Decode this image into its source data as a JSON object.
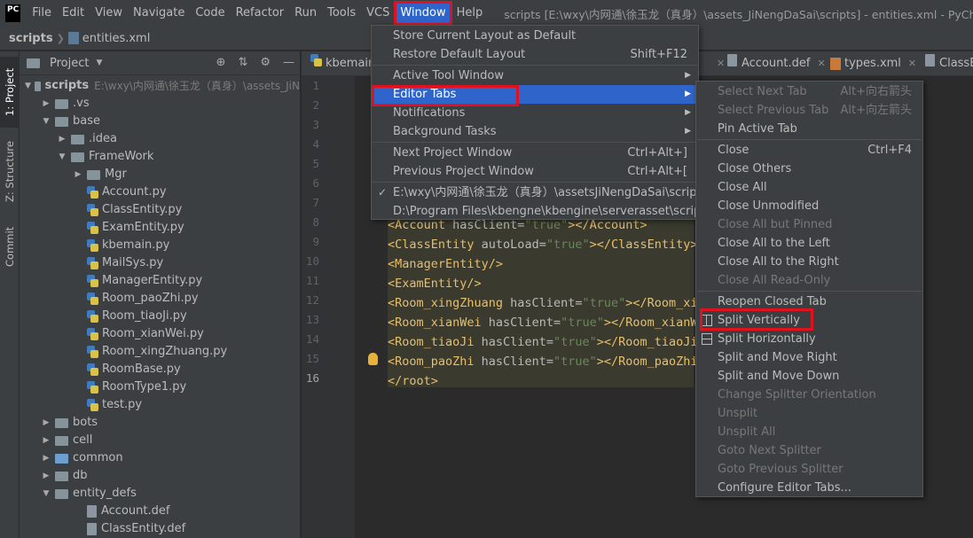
{
  "app": {
    "logo_text": "PC",
    "title": "scripts [E:\\wxy\\内网通\\徐玉龙（真身）\\assets_JiNengDaSai\\scripts] - entities.xml - PyCharm"
  },
  "menubar": [
    "File",
    "Edit",
    "View",
    "Navigate",
    "Code",
    "Refactor",
    "Run",
    "Tools",
    "VCS",
    "Window",
    "Help"
  ],
  "navbar": {
    "root": "scripts",
    "file": "entities.xml"
  },
  "toolstrip": {
    "project": "1: Project",
    "structure": "Z: Structure",
    "commit": "Commit"
  },
  "project_panel": {
    "title": "Project",
    "root": {
      "name": "scripts",
      "path": "E:\\wxy\\内网通\\徐玉龙（真身）\\assets_JiN"
    },
    "rows": [
      {
        "label": ".vs",
        "depth": 1,
        "kind": "folder",
        "arrow": "▶"
      },
      {
        "label": "base",
        "depth": 1,
        "kind": "folder",
        "arrow": "▼"
      },
      {
        "label": ".idea",
        "depth": 2,
        "kind": "folder",
        "arrow": "▶"
      },
      {
        "label": "FrameWork",
        "depth": 2,
        "kind": "folder",
        "arrow": "▼"
      },
      {
        "label": "Mgr",
        "depth": 3,
        "kind": "folder",
        "arrow": "▶"
      },
      {
        "label": "Account.py",
        "depth": 3,
        "kind": "py",
        "arrow": ""
      },
      {
        "label": "ClassEntity.py",
        "depth": 3,
        "kind": "py",
        "arrow": ""
      },
      {
        "label": "ExamEntity.py",
        "depth": 3,
        "kind": "py",
        "arrow": ""
      },
      {
        "label": "kbemain.py",
        "depth": 3,
        "kind": "py",
        "arrow": ""
      },
      {
        "label": "MailSys.py",
        "depth": 3,
        "kind": "py",
        "arrow": ""
      },
      {
        "label": "ManagerEntity.py",
        "depth": 3,
        "kind": "py",
        "arrow": ""
      },
      {
        "label": "Room_paoZhi.py",
        "depth": 3,
        "kind": "py",
        "arrow": ""
      },
      {
        "label": "Room_tiaoJi.py",
        "depth": 3,
        "kind": "py",
        "arrow": ""
      },
      {
        "label": "Room_xianWei.py",
        "depth": 3,
        "kind": "py",
        "arrow": ""
      },
      {
        "label": "Room_xingZhuang.py",
        "depth": 3,
        "kind": "py",
        "arrow": ""
      },
      {
        "label": "RoomBase.py",
        "depth": 3,
        "kind": "py",
        "arrow": ""
      },
      {
        "label": "RoomType1.py",
        "depth": 3,
        "kind": "py",
        "arrow": ""
      },
      {
        "label": "test.py",
        "depth": 3,
        "kind": "py",
        "arrow": ""
      },
      {
        "label": "bots",
        "depth": 1,
        "kind": "folder",
        "arrow": "▶"
      },
      {
        "label": "cell",
        "depth": 1,
        "kind": "folder",
        "arrow": "▶"
      },
      {
        "label": "common",
        "depth": 1,
        "kind": "folder-blue",
        "arrow": "▶"
      },
      {
        "label": "db",
        "depth": 1,
        "kind": "folder",
        "arrow": "▶"
      },
      {
        "label": "entity_defs",
        "depth": 1,
        "kind": "folder",
        "arrow": "▼"
      },
      {
        "label": "Account.def",
        "depth": 3,
        "kind": "def",
        "arrow": ""
      },
      {
        "label": "ClassEntity.def",
        "depth": 3,
        "kind": "def",
        "arrow": ""
      }
    ]
  },
  "editor": {
    "tabs": [
      "kbemain",
      "Account.def",
      "types.xml",
      "ClassEn"
    ],
    "line_numbers": [
      "1",
      "2",
      "3",
      "4",
      "5",
      "6",
      "7",
      "8",
      "9",
      "10",
      "11",
      "12",
      "13",
      "14",
      "15",
      "16"
    ],
    "code_lines": [
      {
        "line": 8,
        "parts": [
          [
            "tag",
            "<Account "
          ],
          [
            "attr",
            "hasClient="
          ],
          [
            "val",
            "\"true\""
          ],
          [
            "tag",
            "></Account>"
          ]
        ]
      },
      {
        "line": 9,
        "parts": [
          [
            "tag",
            "<ClassEntity "
          ],
          [
            "attr",
            "autoLoad="
          ],
          [
            "val",
            "\"true\""
          ],
          [
            "tag",
            "></ClassEntity>"
          ]
        ]
      },
      {
        "line": 10,
        "parts": [
          [
            "tag",
            "<ManagerEntity/>"
          ]
        ]
      },
      {
        "line": 11,
        "parts": [
          [
            "tag",
            "<ExamEntity/>"
          ]
        ]
      },
      {
        "line": 12,
        "parts": [
          [
            "tag",
            "<Room_xingZhuang "
          ],
          [
            "attr",
            "hasClient="
          ],
          [
            "val",
            "\"true\""
          ],
          [
            "tag",
            "></Room_xin"
          ]
        ]
      },
      {
        "line": 13,
        "parts": [
          [
            "tag",
            "<Room_xianWei "
          ],
          [
            "attr",
            "hasClient="
          ],
          [
            "val",
            "\"true\""
          ],
          [
            "tag",
            "></Room_xianWe"
          ]
        ]
      },
      {
        "line": 14,
        "parts": [
          [
            "tag",
            "<Room_tiaoJi "
          ],
          [
            "attr",
            "hasClient="
          ],
          [
            "val",
            "\"true\""
          ],
          [
            "tag",
            "></Room_tiaoJi"
          ]
        ]
      },
      {
        "line": 15,
        "parts": [
          [
            "tag",
            "<Room_paoZhi "
          ],
          [
            "attr",
            "hasClient="
          ],
          [
            "val",
            "\"true\""
          ],
          [
            "tag",
            "></Room_paoZhis"
          ]
        ]
      },
      {
        "line": 16,
        "parts": [
          [
            "tag",
            "</root>"
          ]
        ]
      }
    ]
  },
  "window_menu": {
    "items": [
      {
        "label": "Store Current Layout as Default",
        "shortcut": ""
      },
      {
        "label": "Restore Default Layout",
        "shortcut": "Shift+F12"
      },
      {
        "sep": true
      },
      {
        "label": "Active Tool Window",
        "submenu": true
      },
      {
        "label": "Editor Tabs",
        "submenu": true,
        "hover": true
      },
      {
        "label": "Notifications",
        "submenu": true
      },
      {
        "label": "Background Tasks",
        "submenu": true
      },
      {
        "sep": true
      },
      {
        "label": "Next Project Window",
        "shortcut": "Ctrl+Alt+]"
      },
      {
        "label": "Previous Project Window",
        "shortcut": "Ctrl+Alt+["
      },
      {
        "sep": true
      },
      {
        "label": "E:\\wxy\\内网通\\徐玉龙（真身）\\assetsJiNengDaSai\\scripts",
        "checked": true
      },
      {
        "label": "D:\\Program Files\\kbengne\\kbengine\\serverasset\\scripts"
      }
    ]
  },
  "editor_tabs_menu": {
    "items": [
      {
        "label": "Select Next Tab",
        "shortcut": "Alt+向右箭头",
        "disabled": true
      },
      {
        "label": "Select Previous Tab",
        "shortcut": "Alt+向左箭头",
        "disabled": true
      },
      {
        "label": "Pin Active Tab"
      },
      {
        "sep": true
      },
      {
        "label": "Close",
        "shortcut": "Ctrl+F4"
      },
      {
        "label": "Close Others"
      },
      {
        "label": "Close All"
      },
      {
        "label": "Close Unmodified"
      },
      {
        "label": "Close All but Pinned",
        "disabled": true
      },
      {
        "label": "Close All to the Left"
      },
      {
        "label": "Close All to the Right"
      },
      {
        "label": "Close All Read-Only",
        "disabled": true
      },
      {
        "sep": true
      },
      {
        "label": "Reopen Closed Tab"
      },
      {
        "label": "Split Vertically",
        "icon": "split-vertical-icon",
        "highlight": true
      },
      {
        "label": "Split Horizontally",
        "icon": "split-horizontal-icon"
      },
      {
        "label": "Split and Move Right"
      },
      {
        "label": "Split and Move Down"
      },
      {
        "label": "Change Splitter Orientation",
        "disabled": true
      },
      {
        "label": "Unsplit",
        "disabled": true
      },
      {
        "label": "Unsplit All",
        "disabled": true
      },
      {
        "label": "Goto Next Splitter",
        "disabled": true
      },
      {
        "label": "Goto Previous Splitter",
        "disabled": true
      },
      {
        "label": "Configure Editor Tabs..."
      }
    ]
  },
  "colors": {
    "menu_bg": "#3c3f41",
    "selection": "#2f65ca",
    "annotation_red": "#e0121f",
    "xml_tag": "#e8bf6a",
    "xml_value": "#6a8759"
  }
}
